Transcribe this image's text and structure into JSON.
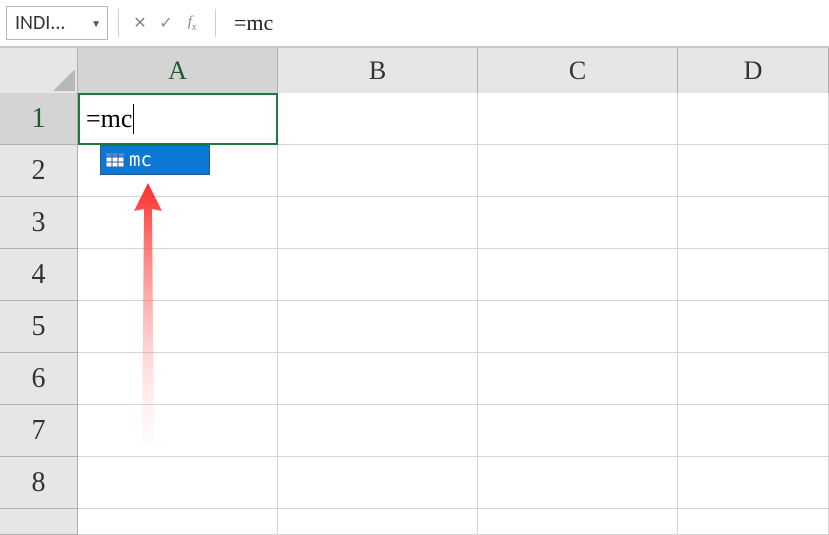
{
  "formula_bar": {
    "name_box": "INDI...",
    "cancel_title": "Cancel",
    "enter_title": "Enter",
    "fx_title": "Insert Function",
    "formula_value": "=mc"
  },
  "columns": [
    "A",
    "B",
    "C",
    "D"
  ],
  "rows": [
    "1",
    "2",
    "3",
    "4",
    "5",
    "6",
    "7",
    "8"
  ],
  "active_cell": {
    "ref": "A1",
    "content": "=mc"
  },
  "autocomplete": {
    "label": "mc"
  }
}
